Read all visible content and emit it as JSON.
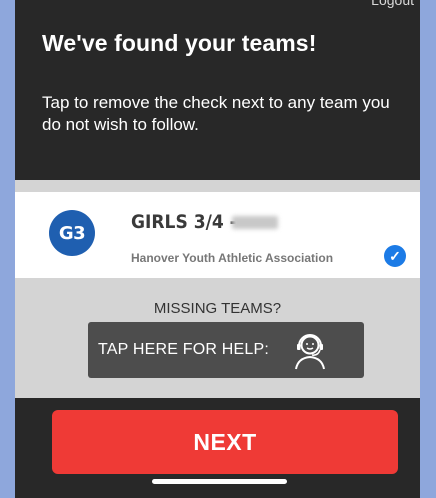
{
  "header": {
    "logout_label": "Logout",
    "title": "We've found your teams!",
    "subtitle": "Tap to remove the check next to any team you do not wish to follow."
  },
  "teams": [
    {
      "badge": "G3",
      "name": "GIRLS 3/4 -",
      "organization": "Hanover Youth Athletic Association",
      "checked": true
    }
  ],
  "help": {
    "missing_label": "MISSING TEAMS?",
    "button_label": "TAP HERE FOR HELP:",
    "icon": "support-agent-icon"
  },
  "footer": {
    "next_label": "NEXT"
  },
  "colors": {
    "background": "#282828",
    "list_background": "#d4d4d4",
    "badge": "#1f5fb0",
    "check": "#1c7be6",
    "next_button": "#ef3a36",
    "help_button": "#4d4d4d"
  }
}
